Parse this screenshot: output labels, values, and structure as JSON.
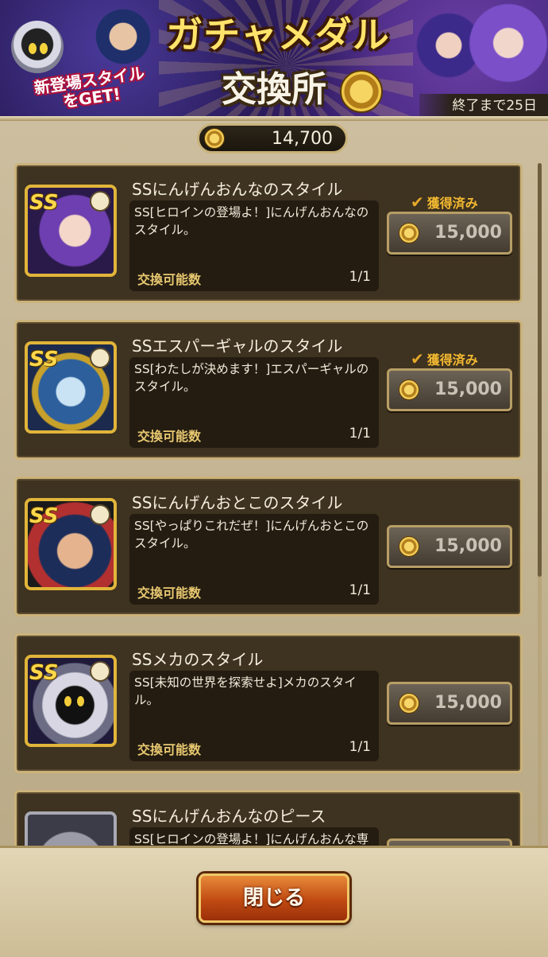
{
  "banner": {
    "title_line1": "ガチャメダル",
    "title_line2": "交換所",
    "tagline_line1": "新登場スタイル",
    "tagline_line2": "をGET!",
    "deadline": "終了まで25日"
  },
  "balance": {
    "icon": "medal-coin-icon",
    "value": "14,700"
  },
  "items": [
    {
      "name": "SSにんげんおんなのスタイル",
      "description": "SS[ヒロインの登場よ！]にんげんおんなのスタイル。",
      "exchange_label": "交換可能数",
      "exchange_count": "1/1",
      "acquired": "獲得済み",
      "price": "15,000"
    },
    {
      "name": "SSエスパーギャルのスタイル",
      "description": "SS[わたしが決めます！]エスパーギャルのスタイル。",
      "exchange_label": "交換可能数",
      "exchange_count": "1/1",
      "acquired": "獲得済み",
      "price": "15,000"
    },
    {
      "name": "SSにんげんおとこのスタイル",
      "description": "SS[やっぱりこれだぜ！]にんげんおとこのスタイル。",
      "exchange_label": "交換可能数",
      "exchange_count": "1/1",
      "acquired": "",
      "price": "15,000"
    },
    {
      "name": "SSメカのスタイル",
      "description": "SS[未知の世界を探索せよ]メカのスタイル。",
      "exchange_label": "交換可能数",
      "exchange_count": "1/1",
      "acquired": "",
      "price": "15,000"
    },
    {
      "name": "SSにんげんおんなのピース",
      "description": "SS[ヒロインの登場よ！]にんげんおんな専",
      "exchange_label": "",
      "exchange_count": "",
      "acquired": "",
      "price": ""
    }
  ],
  "footer": {
    "close_label": "閉じる"
  },
  "colors": {
    "accent_gold": "#e1b53a",
    "acquired_orange": "#f2b830",
    "close_button": "#c04a12"
  }
}
